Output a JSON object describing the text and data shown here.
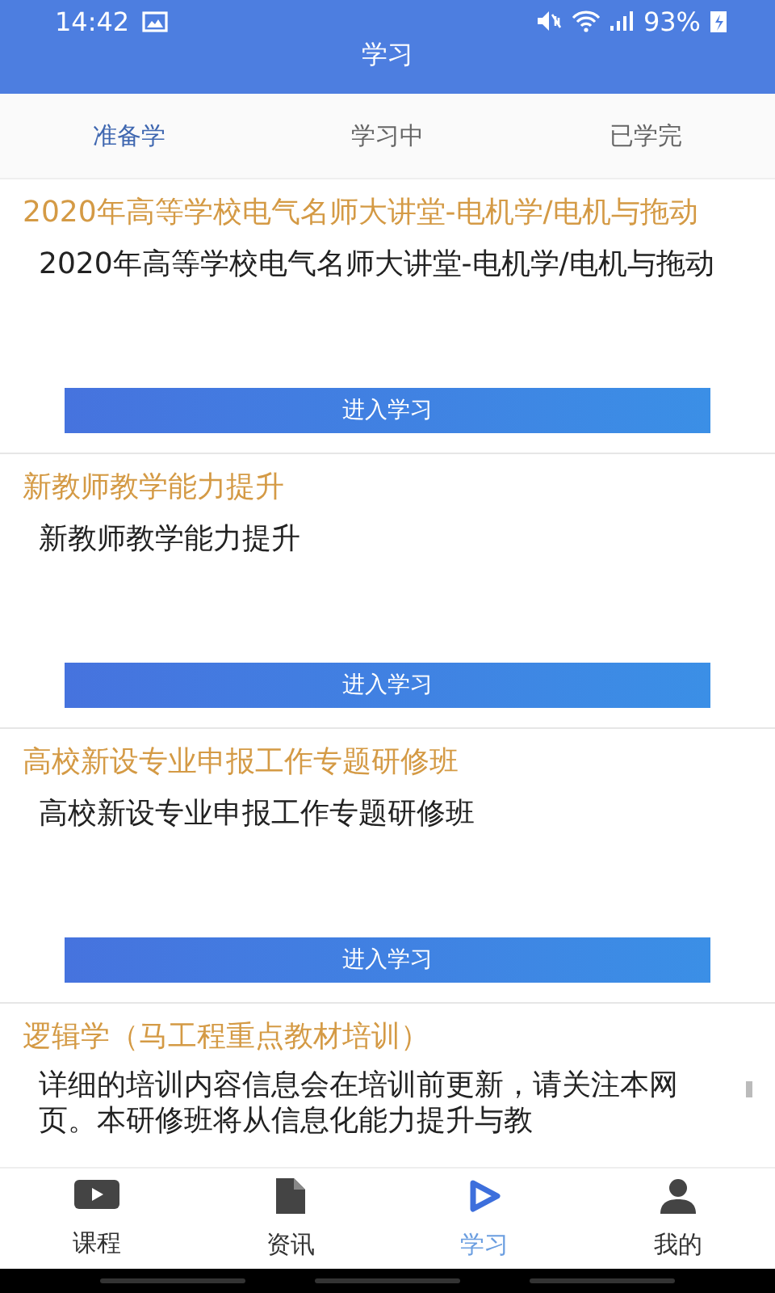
{
  "status_bar": {
    "time": "14:42",
    "battery": "93%"
  },
  "header": {
    "title": "学习"
  },
  "tabs": [
    {
      "label": "准备学",
      "selected": true
    },
    {
      "label": "学习中",
      "selected": false
    },
    {
      "label": "已学完",
      "selected": false
    }
  ],
  "courses": [
    {
      "title": "2020年高等学校电气名师大讲堂-电机学/电机与拖动",
      "description": "2020年高等学校电气名师大讲堂-电机学/电机与拖动",
      "button": "进入学习"
    },
    {
      "title": "新教师教学能力提升",
      "description": "新教师教学能力提升",
      "button": "进入学习"
    },
    {
      "title": "高校新设专业申报工作专题研修班",
      "description": "高校新设专业申报工作专题研修班",
      "button": "进入学习"
    },
    {
      "title": "逻辑学（马工程重点教材培训）",
      "description": "详细的培训内容信息会在培训前更新，请关注本网页。本研修班将从信息化能力提升与教"
    }
  ],
  "bottom_nav": [
    {
      "label": "课程",
      "kind": "video",
      "selected": false
    },
    {
      "label": "资讯",
      "kind": "document",
      "selected": false
    },
    {
      "label": "学习",
      "kind": "play",
      "selected": true
    },
    {
      "label": "我的",
      "kind": "person",
      "selected": false
    }
  ]
}
